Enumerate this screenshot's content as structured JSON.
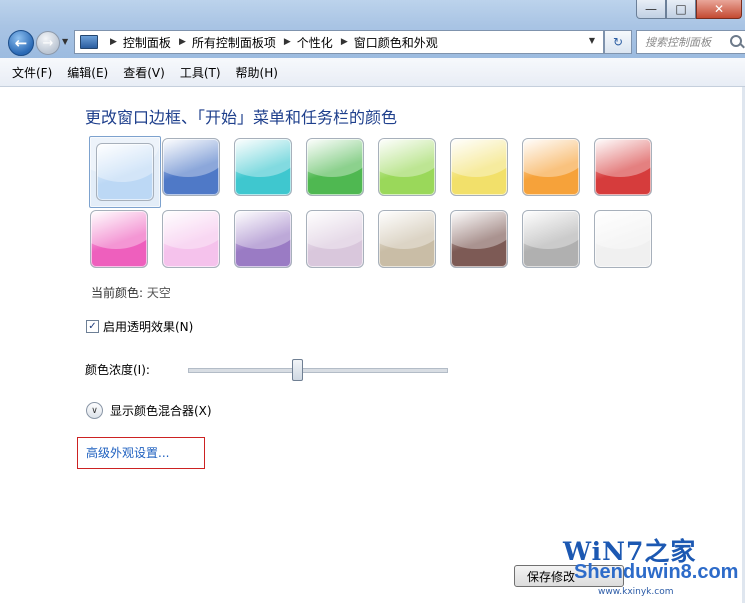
{
  "window": {
    "controls": {
      "minimize": "—",
      "maximize": "□",
      "close": "✕"
    }
  },
  "nav": {
    "breadcrumbs": [
      "控制面板",
      "所有控制面板项",
      "个性化",
      "窗口颜色和外观"
    ],
    "search_placeholder": "搜索控制面板",
    "icons": {
      "back": "back-arrow-icon",
      "forward": "forward-arrow-icon",
      "refresh": "refresh-icon",
      "search": "search-icon"
    }
  },
  "menu": {
    "items": [
      "文件(F)",
      "编辑(E)",
      "查看(V)",
      "工具(T)",
      "帮助(H)"
    ]
  },
  "main": {
    "heading": "更改窗口边框、「开始」菜单和任务栏的颜色",
    "swatches": [
      {
        "row": 0,
        "col": 0,
        "color": "#bcd8f5",
        "selected": true
      },
      {
        "row": 0,
        "col": 1,
        "color": "#4f79c7",
        "selected": false
      },
      {
        "row": 0,
        "col": 2,
        "color": "#3fc7cf",
        "selected": false
      },
      {
        "row": 0,
        "col": 3,
        "color": "#4fb851",
        "selected": false
      },
      {
        "row": 0,
        "col": 4,
        "color": "#9ad85a",
        "selected": false
      },
      {
        "row": 0,
        "col": 5,
        "color": "#f2e06a",
        "selected": false
      },
      {
        "row": 0,
        "col": 6,
        "color": "#f6a23a",
        "selected": false
      },
      {
        "row": 0,
        "col": 7,
        "color": "#d63c3c",
        "selected": false
      },
      {
        "row": 1,
        "col": 0,
        "color": "#ee5fbd",
        "selected": false
      },
      {
        "row": 1,
        "col": 1,
        "color": "#f5c2ec",
        "selected": false
      },
      {
        "row": 1,
        "col": 2,
        "color": "#9a7bc4",
        "selected": false
      },
      {
        "row": 1,
        "col": 3,
        "color": "#d9c7dc",
        "selected": false
      },
      {
        "row": 1,
        "col": 4,
        "color": "#c9bda6",
        "selected": false
      },
      {
        "row": 1,
        "col": 5,
        "color": "#7d5a55",
        "selected": false
      },
      {
        "row": 1,
        "col": 6,
        "color": "#b0b0b0",
        "selected": false
      },
      {
        "row": 1,
        "col": 7,
        "color": "#f0f0f0",
        "selected": false
      }
    ],
    "current_color_label": "当前颜色:",
    "current_color_value": "天空",
    "transparency": {
      "label": "启用透明效果(N)",
      "checked": true
    },
    "intensity": {
      "label": "颜色浓度(I):",
      "value_percent": 42
    },
    "mixer_label": "显示颜色混合器(X)",
    "advanced_link": "高级外观设置...",
    "save_button": "保存修改"
  },
  "watermark": {
    "line1": "WiN7之家",
    "line2": "Shenduwin8.com",
    "line3": "www.kxinyk.com"
  }
}
